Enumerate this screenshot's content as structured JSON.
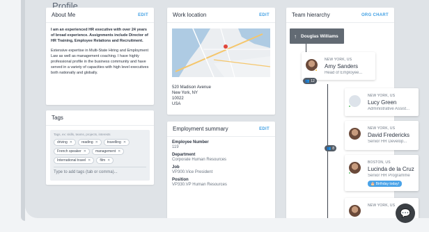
{
  "page": {
    "title": "Profile"
  },
  "about": {
    "title": "About Me",
    "edit_label": "EDIT",
    "bold_text": "I am an experienced HR executive with over 24 years of broad experience. Assignments include Director of HR Training, Employee Relations and Recruitment.",
    "body_text": "Extensive expertise in Multi-State Hiring and Employment Law as well as management coaching. I have highly professional profile in the business community and have served in a variety of capacities with high level executives both nationally and globally."
  },
  "tags": {
    "title": "Tags",
    "placeholder_hint": "Tags, ex: skills, teams, projects, interests",
    "items": [
      "driving",
      "reading",
      "travelling",
      "French speaker",
      "management",
      "International travel",
      "film"
    ],
    "input_placeholder": "Type to add tags (tab or comma)..."
  },
  "work_location": {
    "title": "Work location",
    "edit_label": "EDIT",
    "address_lines": [
      "520 Madison Avenue",
      "New York, NY",
      "10022",
      "USA"
    ]
  },
  "employment": {
    "title": "Employment summary",
    "edit_label": "EDIT",
    "fields": [
      {
        "label": "Employee Number",
        "value": "119"
      },
      {
        "label": "Department",
        "value": "Corporate Human Resources"
      },
      {
        "label": "Job",
        "value": "VP300.Vice President"
      },
      {
        "label": "Position",
        "value": "VP330.VP Human Resources"
      }
    ]
  },
  "team": {
    "title": "Team hierarchy",
    "org_chart_label": "ORG CHART",
    "manager": {
      "name": "Douglas Williams",
      "icon": "arrow-up-icon"
    },
    "people": [
      {
        "location": "NEW YORK, US",
        "name": "Amy Sanders",
        "role": "Head of Employee...",
        "count": "12",
        "status_color": "#f2b530"
      },
      {
        "location": "NEW YORK, US",
        "name": "Lucy Green",
        "role": "Administrative Assist...",
        "count": "",
        "status_color": "#5cc168"
      },
      {
        "location": "NEW YORK, US",
        "name": "David Fredericks",
        "role": "Senior HR Develop...",
        "count": "8",
        "status_color": ""
      },
      {
        "location": "BOSTON, US",
        "name": "Lucinda de la Cruz",
        "role": "Senior HR Programme",
        "count": "",
        "status_color": "#5cc168",
        "badge": "Birthday today!"
      },
      {
        "location": "NEW YORK, US",
        "name": "",
        "role": "",
        "count": "",
        "status_color": ""
      }
    ]
  },
  "colors": {
    "accent": "#3f9fe3",
    "manager_bg": "#626a73",
    "badge": "#4aa3e8"
  }
}
